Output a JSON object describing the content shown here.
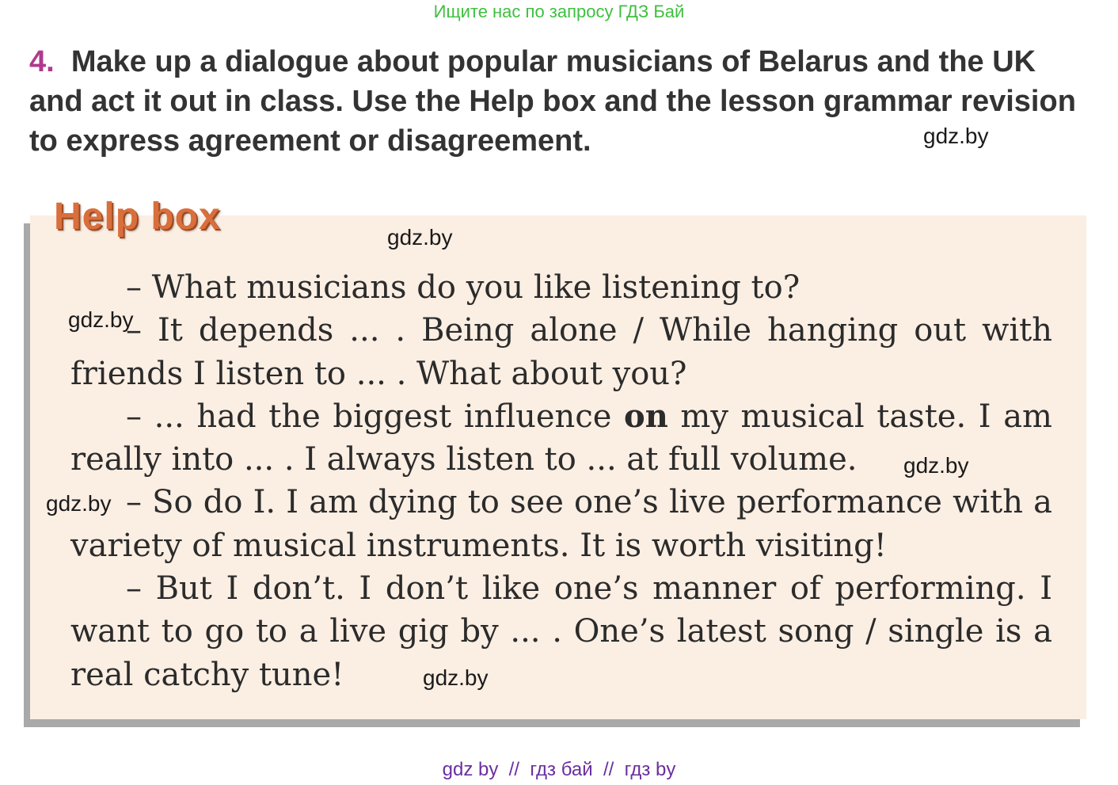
{
  "header": {
    "banner": "Ищите нас по запросу ГДЗ Бай"
  },
  "task": {
    "number": "4.",
    "text": "Make up a dialogue about popular musicians of Belarus and the UK and act it out in class. Use the Help box and the lesson grammar revision to express agreement or disagreement."
  },
  "help_box": {
    "title": "Help box",
    "lines": [
      {
        "text": "– What musicians do you like listening to?"
      },
      {
        "text": "– It depends ... . Being alone / While hanging out with friends I listen to ... . What about you?"
      },
      {
        "before": "– ... had the biggest influence ",
        "bold": "on",
        "after": " my musical taste. I am really into ... . I always listen to ... at full volume."
      },
      {
        "text": "– So do I. I am dying to see one’s live performance with a variety of musical instruments. It is worth visiting!"
      },
      {
        "text": "– But I don’t. I don’t like one’s manner of performing. I want to go to a live gig by ... . One’s latest song / single is a real catchy tune!"
      }
    ]
  },
  "watermarks": {
    "w1": "gdz.by",
    "w2": "gdz.by",
    "w3": "gdz.by",
    "w4": "gdz.by",
    "w5": "gdz.by",
    "w6": "gdz.by"
  },
  "footer": {
    "text": "gdz by  //  гдз бай  //  гдз by"
  },
  "colors": {
    "banner": "#3fbf3f",
    "task_number": "#b03a8c",
    "help_title": "#d96f3c",
    "box_background": "#fbeee3",
    "footer": "#6a2fa0"
  }
}
